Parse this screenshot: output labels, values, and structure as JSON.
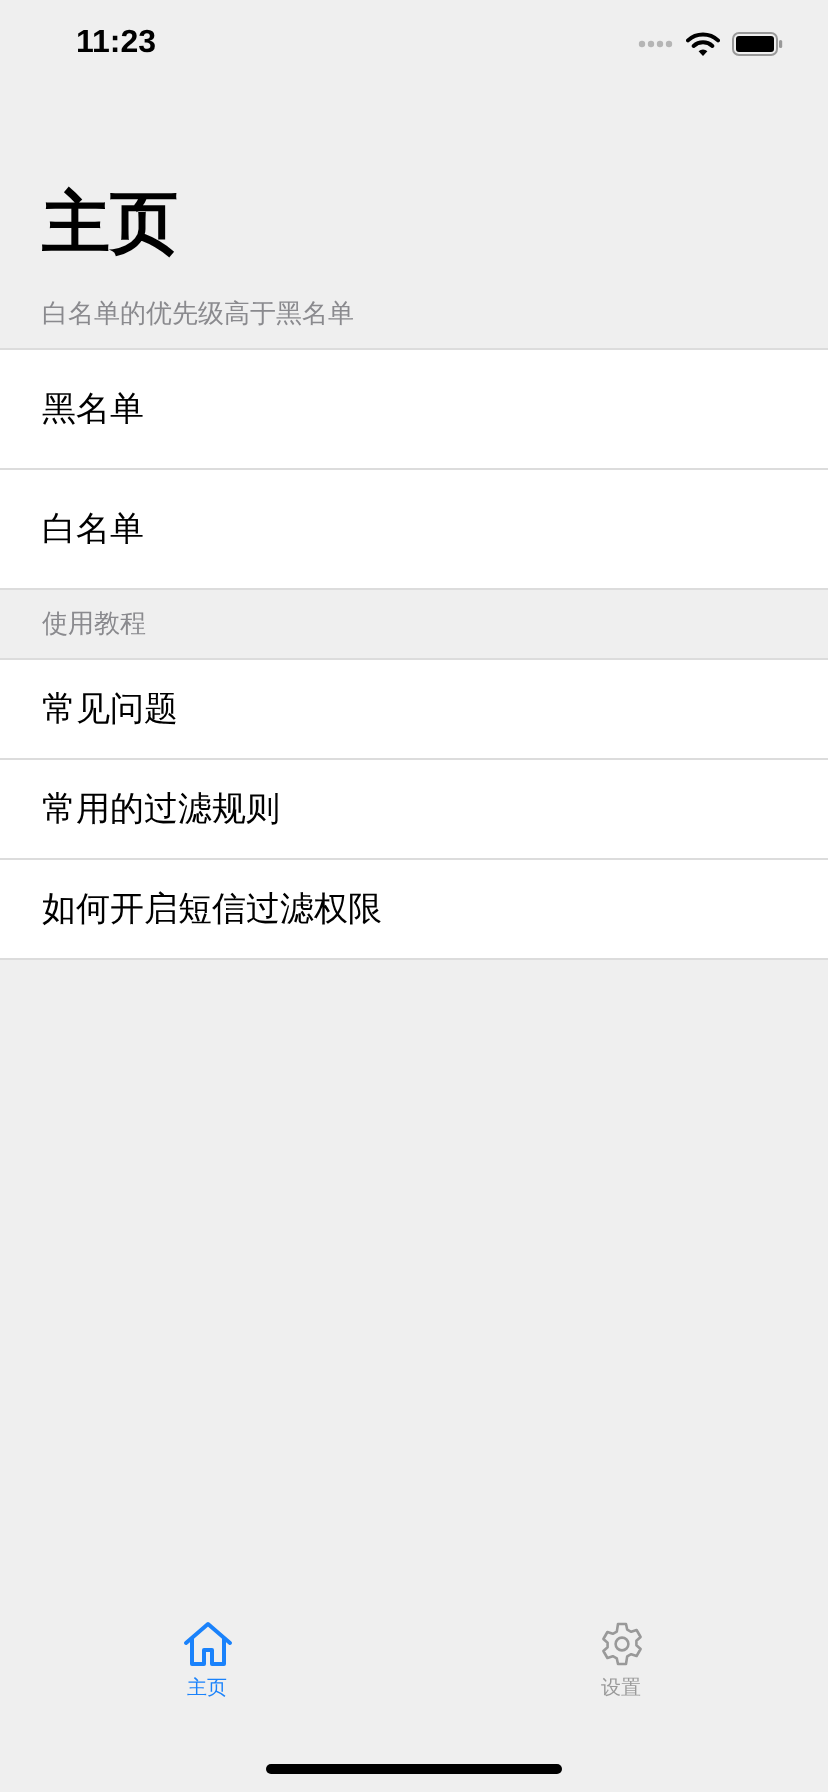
{
  "status_bar": {
    "time": "11:23"
  },
  "title": "主页",
  "sections": [
    {
      "header": "白名单的优先级高于黑名单",
      "items": [
        "黑名单",
        "白名单"
      ]
    },
    {
      "header": "使用教程",
      "items": [
        "常见问题",
        "常用的过滤规则",
        "如何开启短信过滤权限"
      ]
    }
  ],
  "tabs": [
    {
      "label": "主页",
      "kind": "home",
      "selected": true
    },
    {
      "label": "设置",
      "kind": "gear",
      "selected": false
    }
  ]
}
